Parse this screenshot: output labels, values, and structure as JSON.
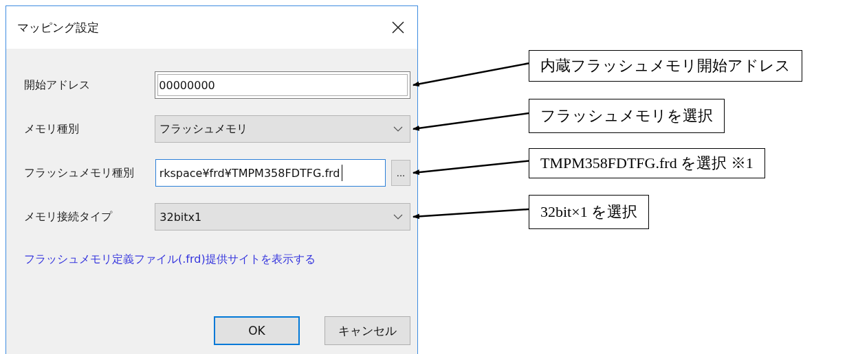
{
  "dialog": {
    "title": "マッピング設定",
    "fields": [
      {
        "kind": "text",
        "label": "開始アドレス",
        "value": "00000000",
        "focused": false
      },
      {
        "kind": "combo",
        "label": "メモリ種別",
        "value": "フラッシュメモリ"
      },
      {
        "kind": "file",
        "label": "フラッシュメモリ種別",
        "value": "rkspace¥frd¥TMPM358FDTFG.frd",
        "focused": true,
        "browse": "..."
      },
      {
        "kind": "combo",
        "label": "メモリ接続タイプ",
        "value": "32bitx1"
      }
    ],
    "link": "フラッシュメモリ定義ファイル(.frd)提供サイトを表示する",
    "buttons": [
      {
        "label": "OK",
        "default": true
      },
      {
        "label": "キャンセル",
        "default": false
      }
    ]
  },
  "callouts": [
    {
      "text": "内蔵フラッシュメモリ開始アドレス"
    },
    {
      "text": "フラッシュメモリを選択"
    },
    {
      "text": "TMPM358FDTFG.frd を選択 ※1"
    },
    {
      "text": "32bit×1 を選択"
    }
  ]
}
